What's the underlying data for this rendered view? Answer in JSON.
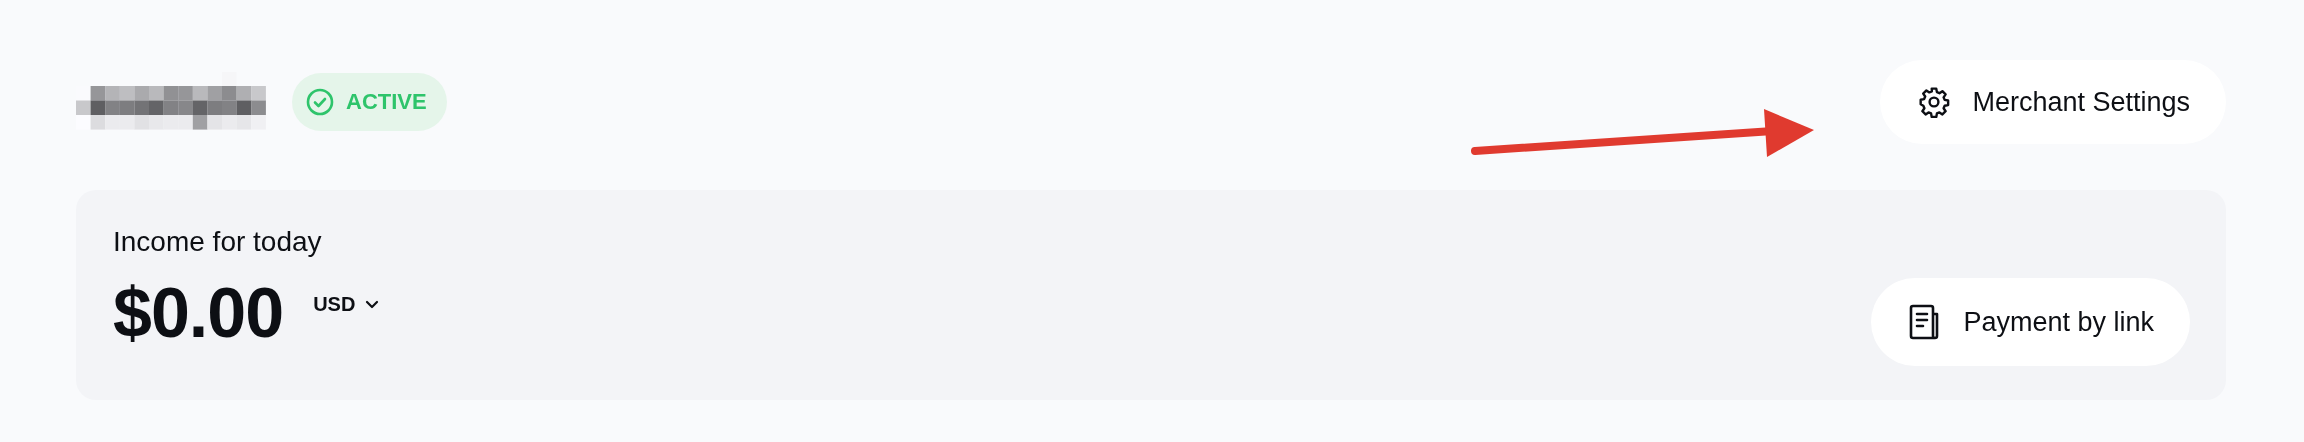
{
  "header": {
    "status": {
      "label": "ACTIVE",
      "kind": "active"
    },
    "settings_button": {
      "label": "Merchant Settings"
    }
  },
  "income": {
    "title": "Income for today",
    "amount": "$0.00",
    "currency": "USD",
    "payment_button": {
      "label": "Payment by link"
    }
  }
}
